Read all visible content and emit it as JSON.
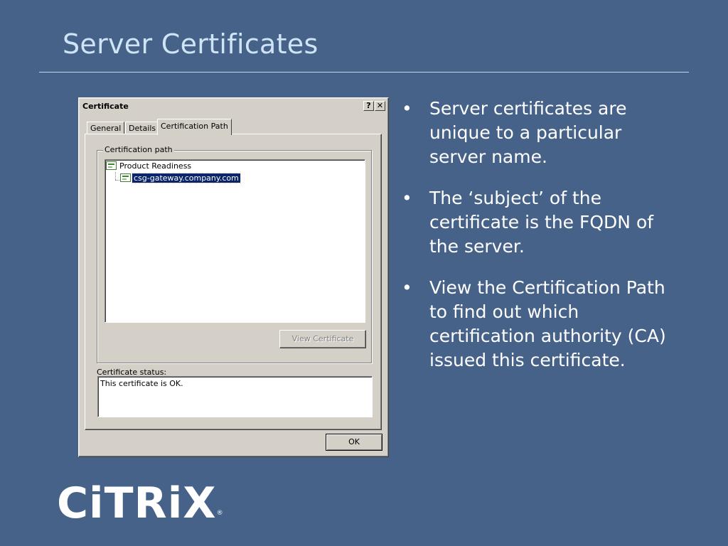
{
  "slide": {
    "title": "Server Certificates",
    "bullets": [
      "Server certificates are unique to a particular server name.",
      "The ‘subject’ of the certificate is the FQDN of the server.",
      "View the Certification Path to find out which certification authority (CA) issued this certificate."
    ],
    "bullet_glyph": "•"
  },
  "dialog": {
    "title": "Certificate",
    "help_label": "?",
    "close_label": "✕",
    "tabs": [
      {
        "label": "General",
        "active": false
      },
      {
        "label": "Details",
        "active": false
      },
      {
        "label": "Certification Path",
        "active": true
      }
    ],
    "group_label": "Certification path",
    "tree": [
      {
        "label": "Product Readiness",
        "level": 0,
        "selected": false
      },
      {
        "label": "csg-gateway.company.com",
        "level": 1,
        "selected": true
      }
    ],
    "view_certificate_label": "View Certificate",
    "status_label": "Certificate status:",
    "status_text": "This certificate is OK.",
    "ok_label": "OK"
  },
  "logo": {
    "text": "CiTRiX",
    "registered": "®"
  },
  "colors": {
    "background": "#466289",
    "title": "#cfe4f7",
    "dialog_face": "#d4d0c8",
    "selection": "#0a246a"
  }
}
